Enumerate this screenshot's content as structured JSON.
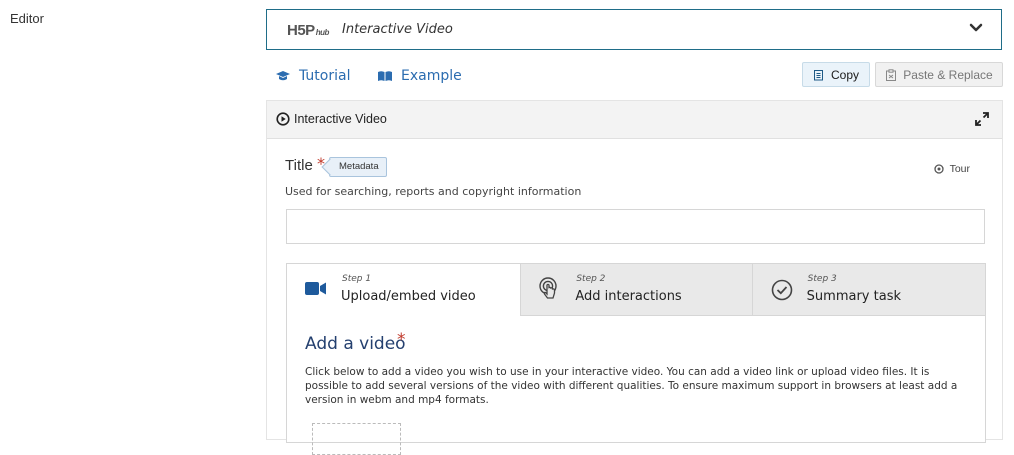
{
  "editor_label": "Editor",
  "content_select": {
    "logo_text": "H5P",
    "logo_sub": "hub",
    "content_type": "Interactive Video",
    "icons": {
      "expand": "chevron-down-icon"
    }
  },
  "links": {
    "tutorial": "Tutorial",
    "example": "Example",
    "tutorial_icon": "graduation-cap-icon",
    "example_icon": "book-icon"
  },
  "buttons": {
    "copy": "Copy",
    "paste_replace": "Paste & Replace"
  },
  "panel": {
    "title": "Interactive Video",
    "field": {
      "label": "Title",
      "required": "*",
      "metadata": "Metadata",
      "tour": "Tour",
      "description": "Used for searching, reports and copyright information",
      "value": ""
    },
    "steps": [
      {
        "step": "Step 1",
        "name": "Upload/embed video",
        "icon": "video-camera-icon",
        "active": true
      },
      {
        "step": "Step 2",
        "name": "Add interactions",
        "icon": "touch-icon",
        "active": false
      },
      {
        "step": "Step 3",
        "name": "Summary task",
        "icon": "check-circle-icon",
        "active": false
      }
    ],
    "add_video": {
      "title": "Add a video",
      "required": "*",
      "description": "Click below to add a video you wish to use in your interactive video. You can add a video link or upload video files. It is possible to add several versions of the video with different qualities. To ensure maximum support in browsers at least add a version in webm and mp4 formats."
    }
  },
  "colors": {
    "accent_blue": "#2b6cb0",
    "border_teal": "#1f6d88",
    "required_red": "#c0392b",
    "heading_navy": "#24406f"
  }
}
